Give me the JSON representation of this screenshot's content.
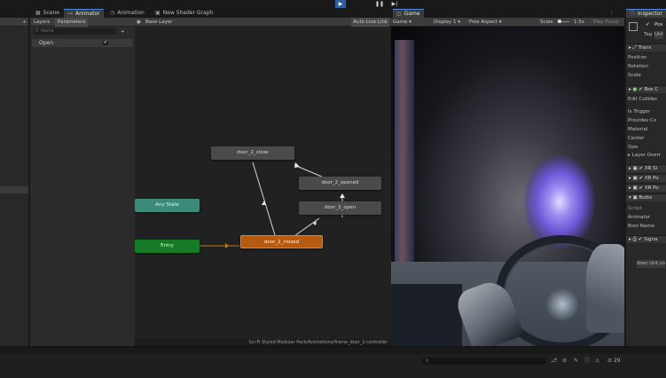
{
  "play_controls": {
    "play": "▶",
    "pause": "❚❚",
    "step": "▶|"
  },
  "hierarchy": {
    "plus": "+",
    "chev": "▾"
  },
  "tabs": {
    "scene": "Scene",
    "animator": "Animator",
    "animation": "Animation",
    "shader": "New Shader Graph",
    "game": "Game",
    "inspector": "Inspector"
  },
  "animator": {
    "layers": "Layers",
    "parameters": "Parameters",
    "search_placeholder": "Name",
    "param_name": "Open",
    "param_checked": "✔",
    "layer": "Base Layer",
    "auto_live_link": "Auto Live Link",
    "path": "Sci-Fi Styled Modular Pack/Animations/frame_door_2.controller"
  },
  "states": {
    "close": "door_2_close",
    "opened": "door_2_opened",
    "open": "door_2_open",
    "closed": "door_2_closed",
    "any": "Any State",
    "entry": "Entry"
  },
  "game": {
    "mode": "Game",
    "display": "Display 1",
    "aspect": "Free Aspect",
    "scale_label": "Scale",
    "scale_value": "1.5x",
    "play_focused": "Play Focus"
  },
  "inspector": {
    "pos": "Pos",
    "tag": "Tag",
    "tag_value": "Unt",
    "transform": "Trans",
    "position": "Position",
    "rotation": "Rotation",
    "scale": "Scale",
    "box_collider": "Box C",
    "edit_collider": "Edit Collider",
    "is_trigger": "Is Trigger",
    "provides": "Provides Co",
    "material": "Material",
    "center": "Center",
    "size": "Size",
    "layer_override": "Layer Overr",
    "xr1": "XR Si",
    "xr2": "XR Po",
    "xr3": "XR Po",
    "butto": "Butto",
    "script": "Script",
    "animator": "Animator",
    "bool_name": "Bool Name",
    "signal": "Signa",
    "door_value": "door Unt.co"
  },
  "console": {
    "search_icon": "⚲",
    "count": "29"
  }
}
